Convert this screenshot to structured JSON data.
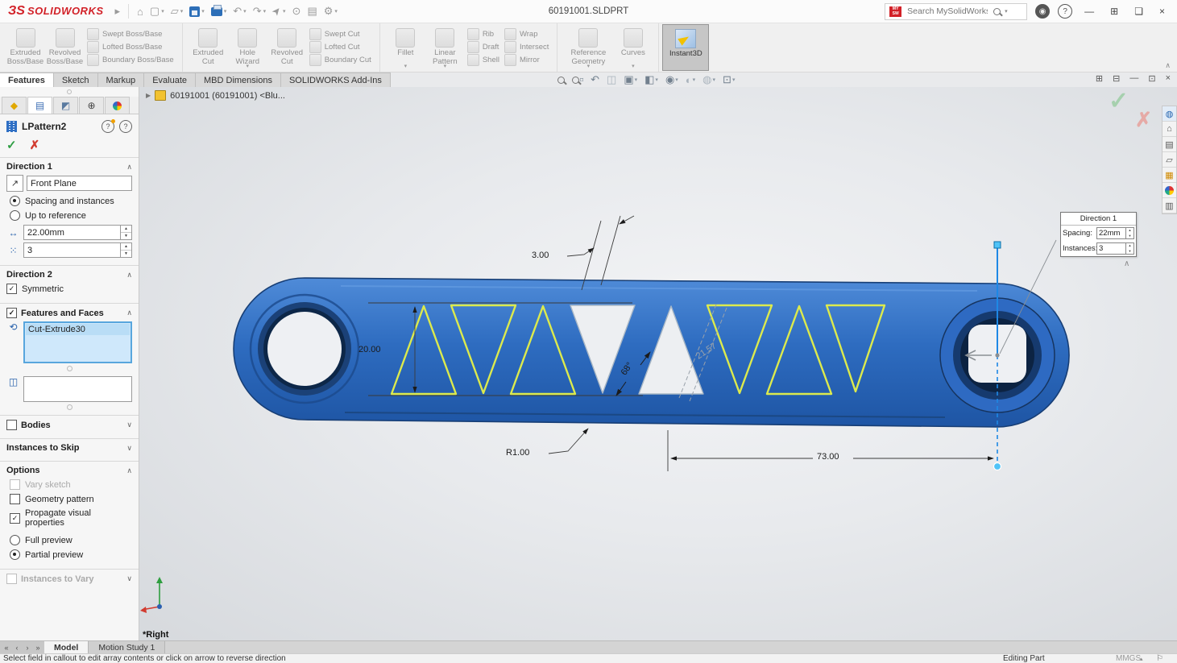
{
  "titlebar": {
    "logo_mark": "ЗS",
    "logo_text": "SOLIDWORKS",
    "filename": "60191001.SLDPRT",
    "search_placeholder": "Search MySolidWorks"
  },
  "ribbon": {
    "g1_big": [
      "Extruded Boss/Base",
      "Revolved Boss/Base"
    ],
    "g1_small": [
      "Swept Boss/Base",
      "Lofted Boss/Base",
      "Boundary Boss/Base"
    ],
    "g2_big": [
      "Extruded Cut",
      "Hole Wizard",
      "Revolved Cut"
    ],
    "g2_small": [
      "Swept Cut",
      "Lofted Cut",
      "Boundary Cut"
    ],
    "g3_big": [
      "Fillet",
      "Linear Pattern"
    ],
    "g3_small1": [
      "Rib",
      "Draft",
      "Shell"
    ],
    "g3_small2": [
      "Wrap",
      "Intersect",
      "Mirror"
    ],
    "g4_big": [
      "Reference Geometry",
      "Curves"
    ],
    "instant3d": "Instant3D"
  },
  "tabs": [
    "Features",
    "Sketch",
    "Markup",
    "Evaluate",
    "MBD Dimensions",
    "SOLIDWORKS Add-Ins"
  ],
  "pm": {
    "title": "LPattern2",
    "d1": {
      "header": "Direction 1",
      "reference": "Front Plane",
      "radio_spacing": "Spacing and instances",
      "radio_upto": "Up to reference",
      "spacing_value": "22.00mm",
      "instances_value": "3"
    },
    "d2": {
      "header": "Direction 2",
      "symmetric": "Symmetric"
    },
    "ff": {
      "header": "Features and Faces",
      "item": "Cut-Extrude30"
    },
    "bodies_header": "Bodies",
    "skip_header": "Instances to Skip",
    "options": {
      "header": "Options",
      "vary": "Vary sketch",
      "geometry": "Geometry pattern",
      "propagate": "Propagate visual properties",
      "full": "Full preview",
      "partial": "Partial preview"
    },
    "vary_header": "Instances to Vary"
  },
  "viewport": {
    "tree_item": "60191001 (60191001) <Blu...",
    "view_label": "*Right",
    "dims": {
      "w": "3.00",
      "h": "20.00",
      "angle": "68°",
      "preview": "21.57",
      "r": "R1.00",
      "len": "73.00"
    },
    "callout": {
      "title": "Direction 1",
      "spacing_label": "Spacing:",
      "spacing_value": "22mm",
      "instances_label": "Instances:",
      "instances_value": "3"
    }
  },
  "bottom": {
    "model_tab": "Model",
    "motion_tab": "Motion Study 1",
    "status": "Select field in callout to edit array contents or click on arrow to reverse direction",
    "mode": "Editing Part",
    "units": "MMGS"
  },
  "colors": {
    "accent_blue": "#2f6fc4",
    "preview_yellow": "#dcea4d",
    "selection_blue": "#cfe8fb"
  }
}
